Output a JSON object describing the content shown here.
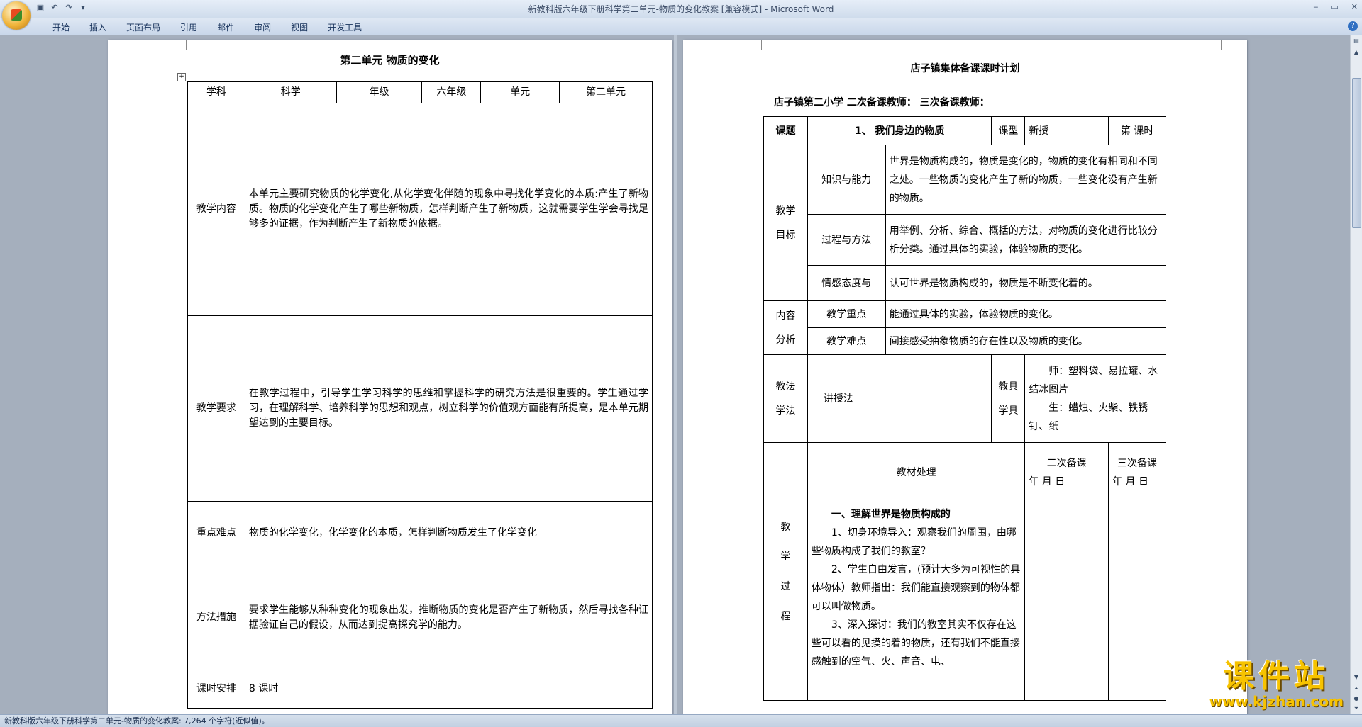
{
  "window": {
    "title": "新教科版六年级下册科学第二单元-物质的变化教案 [兼容模式] - Microsoft Word",
    "controls": [
      "‒",
      "▭",
      "✕"
    ]
  },
  "ribbon": {
    "tabs": [
      "开始",
      "插入",
      "页面布局",
      "引用",
      "邮件",
      "审阅",
      "视图",
      "开发工具"
    ]
  },
  "left_page": {
    "title": "第二单元  物质的变化",
    "header_row": [
      "学科",
      "科学",
      "年级",
      "六年级",
      "单元",
      "第二单元"
    ],
    "rows": [
      {
        "label": "教学内容",
        "text": "本单元主要研究物质的化学变化,从化学变化伴随的现象中寻找化学变化的本质:产生了新物质。物质的化学变化产生了哪些新物质，怎样判断产生了新物质，这就需要学生学会寻找足够多的证据，作为判断产生了新物质的依据。"
      },
      {
        "label": "教学要求",
        "text": "在教学过程中，引导学生学习科学的思维和掌握科学的研究方法是很重要的。学生通过学习，在理解科学、培养科学的思想和观点，树立科学的价值观方面能有所提高，是本单元期望达到的主要目标。"
      },
      {
        "label": "重点难点",
        "text": "物质的化学变化，化学变化的本质，怎样判断物质发生了化学变化"
      },
      {
        "label": "方法措施",
        "text": "要求学生能够从种种变化的现象出发，推断物质的变化是否产生了新物质，然后寻找各种证据验证自己的假设，从而达到提高探究学的能力。"
      },
      {
        "label": "课时安排",
        "text": "8 课时"
      }
    ]
  },
  "right_page": {
    "title": "店子镇集体备课课时计划",
    "subtitle": "店子镇第二小学        二次备课教师：              三次备课教师：",
    "topic_label": "课题",
    "topic": "1、  我们身边的物质",
    "type_label": "课型",
    "type_value": "新授",
    "period_label": "第    课时",
    "goals_label": [
      "教学",
      "目标"
    ],
    "goals": [
      {
        "label": "知识与能力",
        "text": "世界是物质构成的，物质是变化的，物质的变化有相同和不同之处。一些物质的变化产生了新的物质，一些变化没有产生新的物质。"
      },
      {
        "label": "过程与方法",
        "text": "用举例、分析、综合、概括的方法，对物质的变化进行比较分析分类。通过具体的实验，体验物质的变化。"
      },
      {
        "label": "情感态度与",
        "text": "认可世界是物质构成的，物质是不断变化着的。"
      }
    ],
    "analysis_label": [
      "内容",
      "分析"
    ],
    "analysis": [
      {
        "label": "教学重点",
        "text": "能通过具体的实验，体验物质的变化。"
      },
      {
        "label": "教学难点",
        "text": "间接感受抽象物质的存在性以及物质的变化。"
      }
    ],
    "method_label": [
      "教法",
      "学法"
    ],
    "method": "讲授法",
    "tools_label": [
      "教具",
      "学具"
    ],
    "tools_teacher": "师：塑料袋、易拉罐、水结冰图片",
    "tools_student": "生：蜡烛、火柴、铁锈钉、纸",
    "process_label": [
      "教",
      "学",
      "过",
      "程"
    ],
    "material_label": "教材处理",
    "second_prep": "二次备课",
    "third_prep": "三次备课",
    "date_label": "年   月  日",
    "process_heading": "一、理解世界是物质构成的",
    "process_steps": [
      "1、切身环境导入：观察我们的周围，由哪些物质构成了我们的教室？",
      "2、学生自由发言，(预计大多为可视性的具体物体）教师指出：我们能直接观察到的物体都可以叫做物质。",
      "3、深入探讨：我们的教室其实不仅存在这些可以看的见摸的着的物质，还有我们不能直接感触到的空气、火、声音、电、"
    ]
  },
  "statusbar": {
    "text": "新教科版六年级下册科学第二单元-物质的变化教案: 7,264 个字符(近似值)。"
  },
  "watermark": {
    "big": "课件站",
    "small": "www.kjzhan.com"
  }
}
